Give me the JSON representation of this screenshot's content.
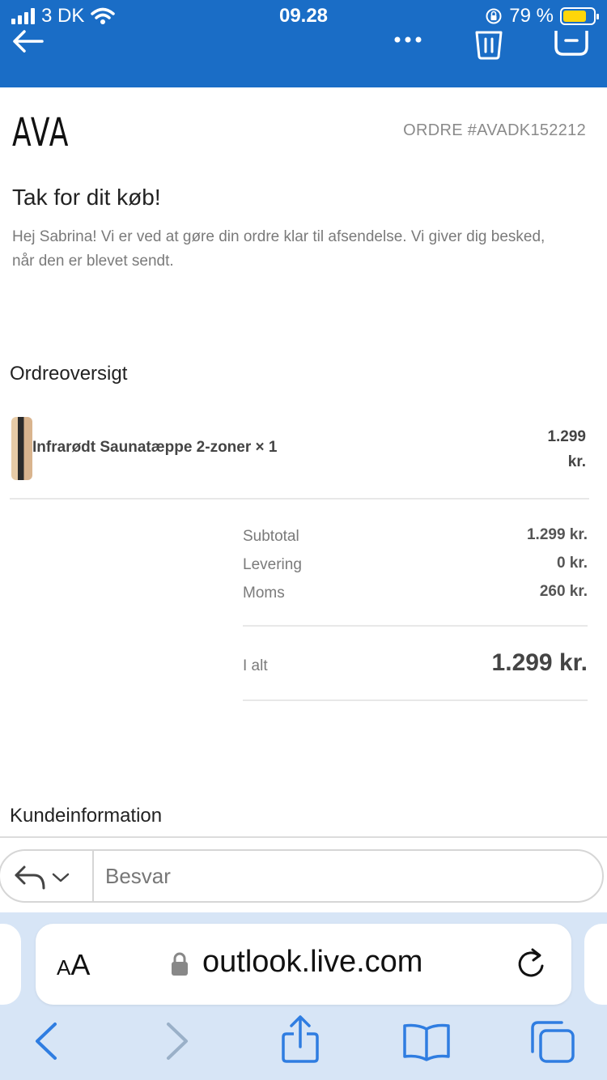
{
  "status_bar": {
    "carrier": "3 DK",
    "time": "09.28",
    "battery_percent": "79 %",
    "battery_level": 0.79
  },
  "mail_toolbar": {
    "icons": [
      "back-arrow-icon",
      "more-dots-icon",
      "trash-icon",
      "archive-icon"
    ]
  },
  "email": {
    "logo": "AVA",
    "order_number": "ORDRE #AVADK152212",
    "heading": "Tak for dit køb!",
    "intro": "Hej Sabrina! Vi er ved at gøre din ordre klar til afsendelse. Vi giver dig besked, når den er blevet sendt.",
    "overview_title": "Ordreoversigt",
    "product": {
      "name": "Infrarødt Saunatæppe 2-zoner × 1",
      "price_line1": "1.299",
      "price_line2": "kr."
    },
    "summary": [
      {
        "label": "Subtotal",
        "value": "1.299 kr."
      },
      {
        "label": "Levering",
        "value": "0 kr."
      },
      {
        "label": "Moms",
        "value": "260 kr."
      }
    ],
    "total_label": "I alt",
    "total_value": "1.299 kr.",
    "customer_info_title": "Kundeinformation"
  },
  "reply": {
    "placeholder": "Besvar"
  },
  "safari": {
    "text_size_label_big": "A",
    "text_size_label_small": "A",
    "url": "outlook.live.com"
  },
  "colors": {
    "toolbar_blue": "#1a6dc6",
    "safari_blue": "#2f7de1",
    "battery_yellow": "#ffd60a"
  }
}
